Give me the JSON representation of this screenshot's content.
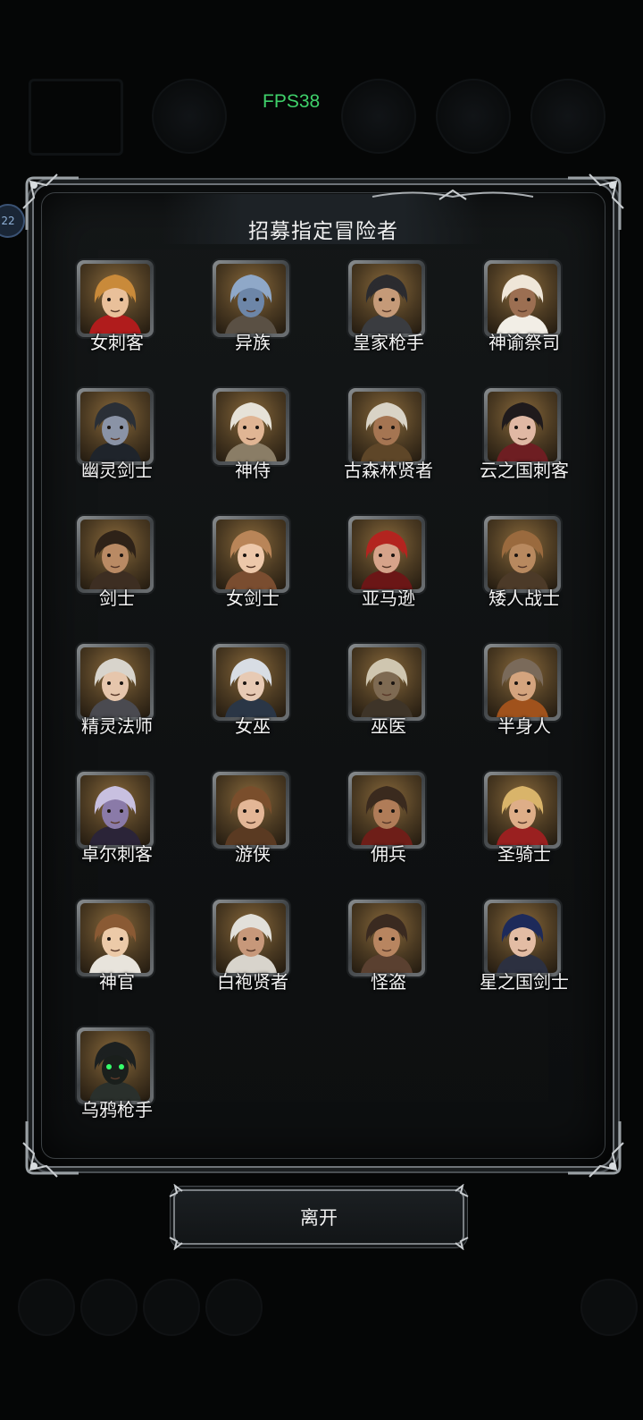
{
  "hud": {
    "fps": "FPS38",
    "side_badge": "22"
  },
  "dialog": {
    "title": "招募指定冒险者",
    "leave_label": "离开",
    "adventurers": [
      {
        "name": "女刺客",
        "hair": "#c98a3a",
        "skin": "#e9c09a",
        "cloth": "#b01c1c"
      },
      {
        "name": "异族",
        "hair": "#8fa8c8",
        "skin": "#6d86a8",
        "cloth": "#5a5044"
      },
      {
        "name": "皇家枪手",
        "hair": "#2b2b2f",
        "skin": "#c59a78",
        "cloth": "#3a3c40"
      },
      {
        "name": "神谕祭司",
        "hair": "#efe6d8",
        "skin": "#9c6f52",
        "cloth": "#f2eee6"
      },
      {
        "name": "幽灵剑士",
        "hair": "#2a2f36",
        "skin": "#8a93a6",
        "cloth": "#1f242b"
      },
      {
        "name": "神侍",
        "hair": "#e6e2d8",
        "skin": "#e0b594",
        "cloth": "#8a7d66"
      },
      {
        "name": "古森林贤者",
        "hair": "#d9d3c6",
        "skin": "#a57552",
        "cloth": "#5e4628"
      },
      {
        "name": "云之国刺客",
        "hair": "#1f1a1c",
        "skin": "#e0b8a4",
        "cloth": "#6e1e22"
      },
      {
        "name": "剑士",
        "hair": "#2e2218",
        "skin": "#b98a64",
        "cloth": "#3d2e22"
      },
      {
        "name": "女剑士",
        "hair": "#b98558",
        "skin": "#edc8aa",
        "cloth": "#7a4d30"
      },
      {
        "name": "亚马逊",
        "hair": "#b3241f",
        "skin": "#d6a38a",
        "cloth": "#6b1616"
      },
      {
        "name": "矮人战士",
        "hair": "#9a6a3e",
        "skin": "#b8895f",
        "cloth": "#4c3a28"
      },
      {
        "name": "精灵法师",
        "hair": "#d8d4cc",
        "skin": "#e6c6ac",
        "cloth": "#4a4a50"
      },
      {
        "name": "女巫",
        "hair": "#d8dde4",
        "skin": "#e7cab4",
        "cloth": "#2a3646"
      },
      {
        "name": "巫医",
        "hair": "#cfc6b0",
        "skin": "#7e6a52",
        "cloth": "#3e3428"
      },
      {
        "name": "半身人",
        "hair": "#7a6a5a",
        "skin": "#d4a47e",
        "cloth": "#a0521c"
      },
      {
        "name": "卓尔刺客",
        "hair": "#c8c0e0",
        "skin": "#8a7aa8",
        "cloth": "#2b2438"
      },
      {
        "name": "游侠",
        "hair": "#7a4e2c",
        "skin": "#e3b696",
        "cloth": "#5a3a22"
      },
      {
        "name": "佣兵",
        "hair": "#3a2a1e",
        "skin": "#b07c58",
        "cloth": "#6e1e18"
      },
      {
        "name": "圣骑士",
        "hair": "#d9b46a",
        "skin": "#deae88",
        "cloth": "#9a2020"
      },
      {
        "name": "神官",
        "hair": "#8a5a34",
        "skin": "#eccaa8",
        "cloth": "#e8e4dc"
      },
      {
        "name": "白袍贤者",
        "hair": "#e2e0da",
        "skin": "#c7987a",
        "cloth": "#d8d4cc"
      },
      {
        "name": "怪盗",
        "hair": "#3a2a20",
        "skin": "#b88560",
        "cloth": "#5a4030"
      },
      {
        "name": "星之国剑士",
        "hair": "#1d2a5a",
        "skin": "#e3bca4",
        "cloth": "#2c3040"
      },
      {
        "name": "乌鸦枪手",
        "hair": "#1c2020",
        "skin": "#1a1f1c",
        "cloth": "#2a302c"
      }
    ]
  },
  "colors": {
    "fps_text": "#3fd06a",
    "panel_border": "#6f7479",
    "eyes_glow": "#35ff6a"
  }
}
